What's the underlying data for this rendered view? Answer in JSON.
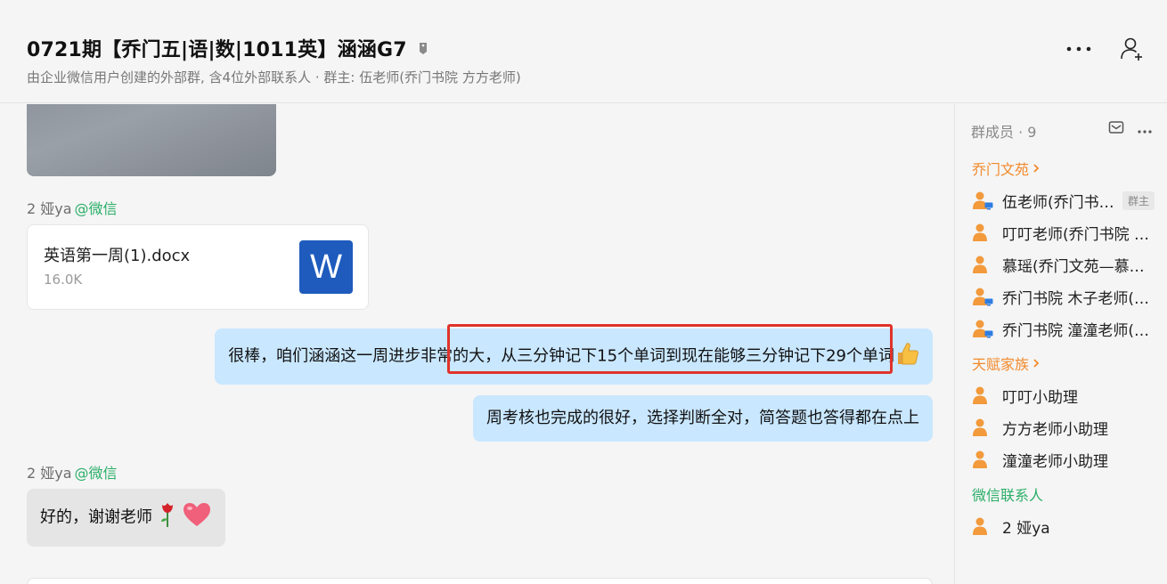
{
  "header": {
    "title": "0721期【乔门五|语|数|1011英】涵涵G7",
    "subtitle": "由企业微信用户创建的外部群, 含4位外部联系人 · 群主: 伍老师(乔门书院 方方老师)"
  },
  "messages": [
    {
      "type": "image",
      "side": "in"
    },
    {
      "type": "file",
      "sender": "2 娅ya",
      "source": "@微信",
      "file_name": "英语第一周(1).docx",
      "file_size": "16.0K",
      "icon": "word-icon",
      "icon_letter": "W"
    },
    {
      "type": "text",
      "side": "out",
      "text_before": "很棒，咱们涵涵这一周进步非常的大，",
      "text_highlight": "从三分钟记下15个单词到现在能够三分钟记下29个单词",
      "emoji": "thumbs-up-icon"
    },
    {
      "type": "text",
      "side": "out",
      "text": "周考核也完成的很好，选择判断全对，简答题也答得都在点上"
    },
    {
      "type": "text",
      "side": "in",
      "sender": "2 娅ya",
      "source": "@微信",
      "text": "好的，谢谢老师",
      "emojis": [
        "rose-icon",
        "heart-icon"
      ]
    }
  ],
  "panel": {
    "title": "群成员 · 9",
    "groups": [
      {
        "label": "乔门文苑",
        "color": "#f28a2c",
        "members": [
          {
            "name": "伍老师(乔门书院 方方老师)",
            "badge": "群主",
            "pc": true
          },
          {
            "name": "叮叮老师(乔门书院 叮叮老师)",
            "pc": false
          },
          {
            "name": "慕瑶(乔门文苑—慕瑶老师)",
            "pc": false
          },
          {
            "name": "乔门书院 木子老师(乔门书院)",
            "pc": true
          },
          {
            "name": "乔门书院 潼潼老师(乔门书院)",
            "pc": true
          }
        ]
      },
      {
        "label": "天赋家族",
        "color": "#f28a2c",
        "members": [
          {
            "name": "叮叮小助理",
            "pc": false
          },
          {
            "name": "方方老师小助理",
            "pc": false
          },
          {
            "name": "潼潼老师小助理",
            "pc": false
          }
        ]
      },
      {
        "label": "微信联系人",
        "color": "#2aae67",
        "members": [
          {
            "name": "2 娅ya",
            "pc": false
          }
        ]
      }
    ]
  },
  "colors": {
    "accent_orange": "#f28a2c",
    "wechat_green": "#2aae67",
    "bubble_out": "#c9e7ff",
    "bubble_in": "#e5e5e5",
    "highlight_red": "#e0332b"
  }
}
